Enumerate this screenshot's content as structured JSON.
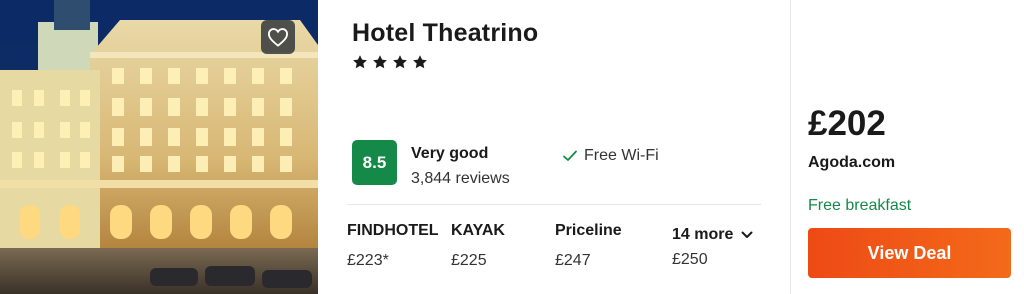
{
  "hotel": {
    "name": "Hotel Theatrino",
    "star_count": 4,
    "star_icon": "star-icon",
    "favorite_icon": "heart-icon"
  },
  "rating": {
    "score": "8.5",
    "label": "Very good",
    "reviews": "3,844 reviews",
    "badge_color": "#158a48"
  },
  "amenities": [
    {
      "icon": "check-icon",
      "label": "Free Wi-Fi"
    }
  ],
  "providers": [
    {
      "name": "FINDHOTEL",
      "price": "£223*"
    },
    {
      "name": "KAYAK",
      "price": "£225"
    },
    {
      "name": "Priceline",
      "price": "£247"
    }
  ],
  "more": {
    "label": "14 more",
    "price": "£250",
    "icon": "chevron-down-icon"
  },
  "deal": {
    "price": "£202",
    "provider": "Agoda.com",
    "perk": "Free breakfast",
    "button_label": "View Deal",
    "button_color": "#f05a1a",
    "perk_color": "#158a48"
  }
}
